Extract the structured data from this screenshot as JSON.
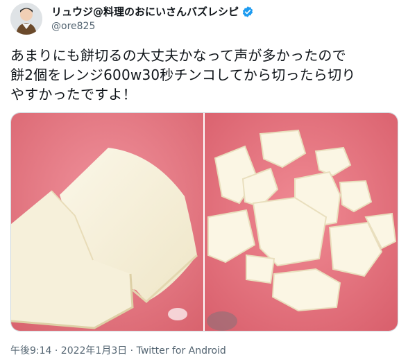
{
  "author": {
    "display_name": "リュウジ@料理のおにいさんバズレシピ",
    "handle": "@ore825",
    "avatar_icon": "avatar-icon",
    "verified_icon": "verified-badge-icon",
    "verified_color": "#1d9bf0"
  },
  "tweet": {
    "lines": [
      "あまりにも餅切るの大丈夫かなって声が多かったので",
      "餅2個をレンジ600w30秒チンコしてから切ったら切り",
      "やすかったですよ！"
    ]
  },
  "media": {
    "photos": [
      {
        "name": "photo-left",
        "background_color": "#e97b88"
      },
      {
        "name": "photo-right",
        "background_color": "#e9747c"
      }
    ]
  },
  "meta": {
    "timestamp": "午後9:14 · 2022年1月3日 · Twitter for Android"
  }
}
